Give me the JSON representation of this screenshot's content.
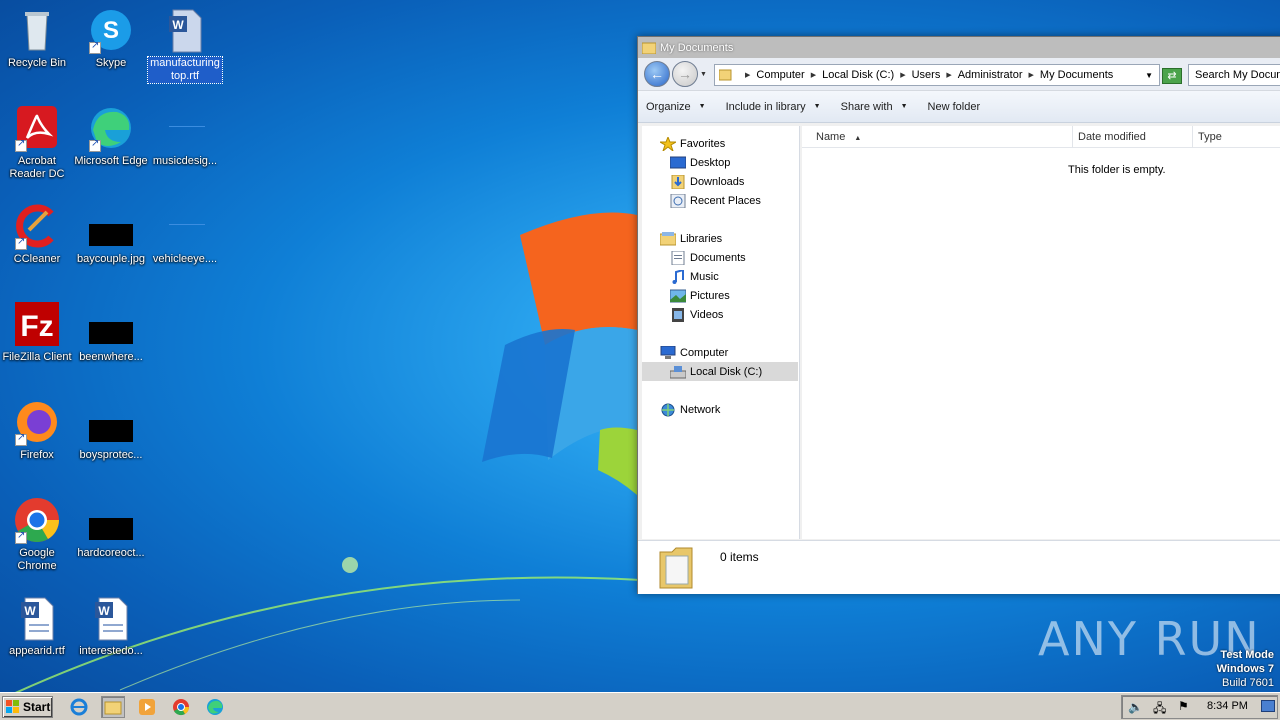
{
  "desktop": {
    "icons": [
      {
        "label": "Recycle Bin",
        "icon": "recycle-bin-icon"
      },
      {
        "label": "Skype",
        "icon": "skype-icon"
      },
      {
        "label": "manufacturing top.rtf",
        "icon": "word-document-icon"
      },
      {
        "label": "Acrobat Reader DC",
        "icon": "acrobat-icon"
      },
      {
        "label": "Microsoft Edge",
        "icon": "edge-icon"
      },
      {
        "label": "musicdesig...",
        "icon": "blank-file-icon"
      },
      {
        "label": "CCleaner",
        "icon": "ccleaner-icon"
      },
      {
        "label": "baycouple.jpg",
        "icon": "image-file-icon"
      },
      {
        "label": "vehicleeye....",
        "icon": "blank-file-icon"
      },
      {
        "label": "FileZilla Client",
        "icon": "filezilla-icon"
      },
      {
        "label": "beenwhere...",
        "icon": "image-file-icon"
      },
      {
        "label": "Firefox",
        "icon": "firefox-icon"
      },
      {
        "label": "boysprotec...",
        "icon": "image-file-icon"
      },
      {
        "label": "Google Chrome",
        "icon": "chrome-icon"
      },
      {
        "label": "hardcoreoct...",
        "icon": "image-file-icon"
      },
      {
        "label": "appearid.rtf",
        "icon": "word-document-icon"
      },
      {
        "label": "interestedo...",
        "icon": "word-document-icon"
      }
    ]
  },
  "window": {
    "title": "My Documents",
    "breadcrumb": [
      "Computer",
      "Local Disk (C:)",
      "Users",
      "Administrator",
      "My Documents"
    ],
    "search_placeholder": "Search My Docum",
    "toolbar": {
      "organize": "Organize",
      "include": "Include in library",
      "share": "Share with",
      "new_folder": "New folder"
    },
    "nav": {
      "favorites": "Favorites",
      "desktop": "Desktop",
      "downloads": "Downloads",
      "recent": "Recent Places",
      "libraries": "Libraries",
      "documents": "Documents",
      "music": "Music",
      "pictures": "Pictures",
      "videos": "Videos",
      "computer": "Computer",
      "local_disk": "Local Disk (C:)",
      "network": "Network"
    },
    "columns": {
      "name": "Name",
      "date": "Date modified",
      "type": "Type"
    },
    "empty_message": "This folder is empty.",
    "items_count": "0 items"
  },
  "taskbar": {
    "start": "Start",
    "clock": "8:34 PM"
  },
  "watermark": {
    "line1": "Test Mode",
    "line2": "Windows 7",
    "line3": "Build 7601",
    "brand": "ANY RUN"
  },
  "colors": {
    "wallpaper_blue": "#0f7fd6",
    "selection": "#1f5ec9",
    "taskbar": "#d4d0c8"
  }
}
